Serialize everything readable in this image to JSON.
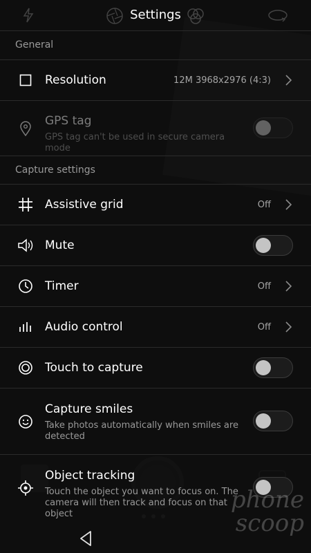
{
  "header": {
    "title": "Settings"
  },
  "sections": {
    "general": "General",
    "capture": "Capture settings"
  },
  "rows": {
    "resolution": {
      "label": "Resolution",
      "value": "12M 3968x2976 (4:3)"
    },
    "gps_tag": {
      "label": "GPS tag",
      "sub": "GPS tag can't be used in secure camera mode",
      "enabled": false,
      "on": false
    },
    "assistive_grid": {
      "label": "Assistive grid",
      "value": "Off"
    },
    "mute": {
      "label": "Mute",
      "on": false
    },
    "timer": {
      "label": "Timer",
      "value": "Off"
    },
    "audio_control": {
      "label": "Audio control",
      "value": "Off"
    },
    "touch_to_capture": {
      "label": "Touch to capture",
      "on": false
    },
    "capture_smiles": {
      "label": "Capture smiles",
      "sub": "Take photos automatically when smiles are detected",
      "on": false
    },
    "object_tracking": {
      "label": "Object tracking",
      "sub": "Touch the object you want to focus on. The camera will then track and focus on that object",
      "on": false
    }
  },
  "watermark": "phone scoop",
  "colors": {
    "background": "#141414",
    "text": "#ffffff",
    "secondary": "#9a9a9a",
    "divider": "#2b2b2b"
  }
}
